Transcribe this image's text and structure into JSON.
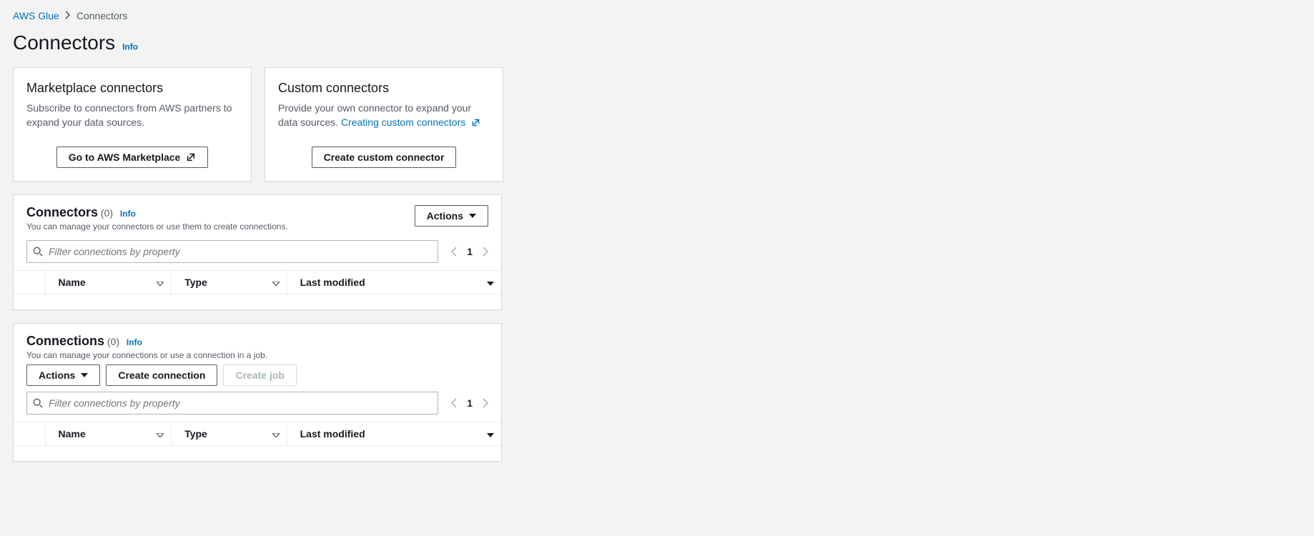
{
  "breadcrumb": {
    "root": "AWS Glue",
    "current": "Connectors"
  },
  "page": {
    "title": "Connectors",
    "info": "Info"
  },
  "cards": {
    "marketplace": {
      "title": "Marketplace connectors",
      "desc": "Subscribe to connectors from AWS partners to expand your data sources.",
      "button": "Go to AWS Marketplace"
    },
    "custom": {
      "title": "Custom connectors",
      "desc": "Provide your own connector to expand your data sources. ",
      "link": "Creating custom connectors",
      "button": "Create custom connector"
    }
  },
  "connectorsPanel": {
    "title": "Connectors",
    "count": "(0)",
    "info": "Info",
    "subtitle": "You can manage your connectors or use them to create connections.",
    "actions": "Actions",
    "searchPlaceholder": "Filter connections by property",
    "page": "1",
    "cols": {
      "name": "Name",
      "type": "Type",
      "lastModified": "Last modified"
    }
  },
  "connectionsPanel": {
    "title": "Connections",
    "count": "(0)",
    "info": "Info",
    "subtitle": "You can manage your connections or use a connection in a job.",
    "actions": "Actions",
    "createConn": "Create connection",
    "createJob": "Create job",
    "searchPlaceholder": "Filter connections by property",
    "page": "1",
    "cols": {
      "name": "Name",
      "type": "Type",
      "lastModified": "Last modified"
    }
  }
}
